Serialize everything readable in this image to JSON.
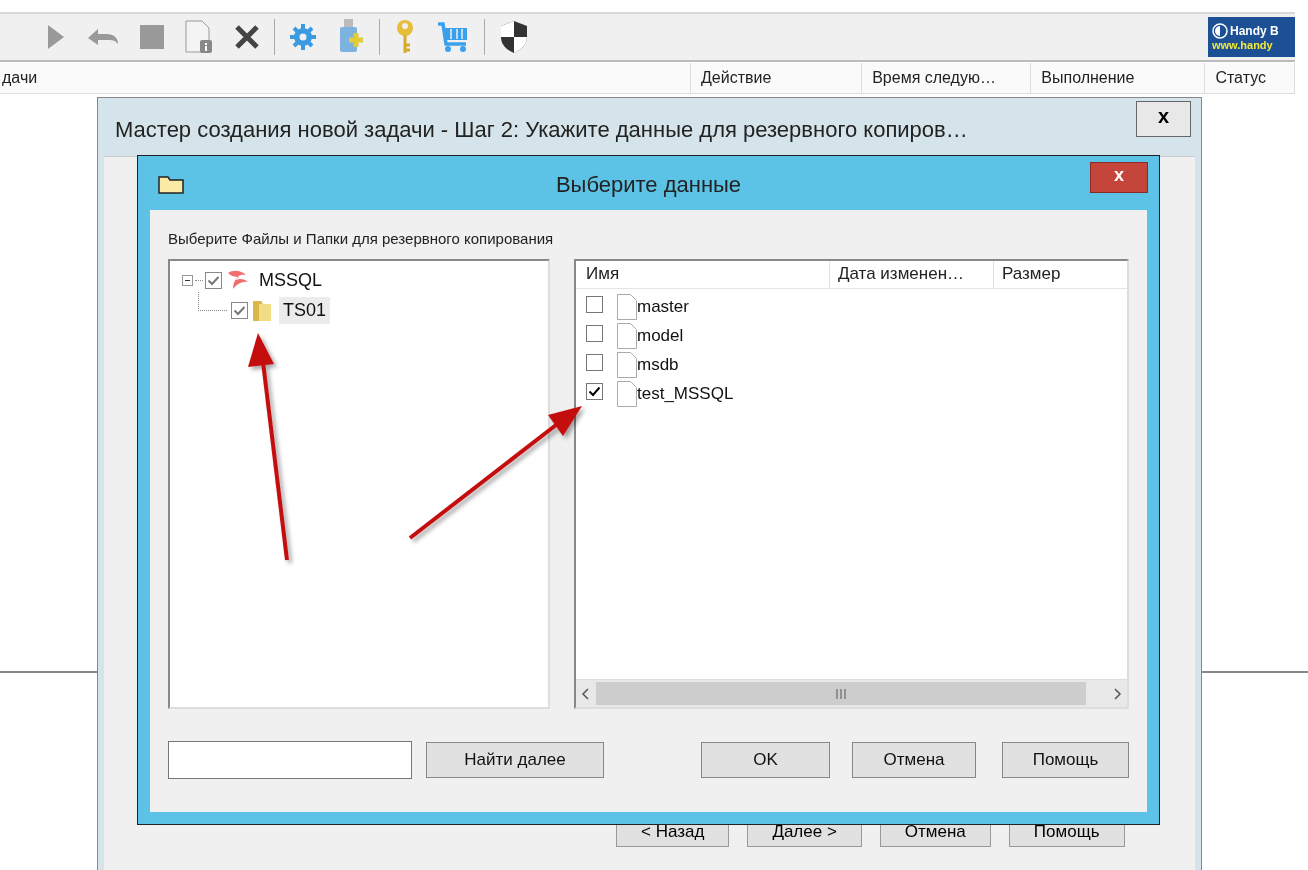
{
  "app": {
    "logo": {
      "line_1": "Handy B",
      "line_2": "www.handy"
    },
    "columns": [
      "дачи",
      "Действие",
      "Время следую…",
      "Выполнение",
      "Статус"
    ]
  },
  "wizard": {
    "title": "Мастер создания новой задачи - Шаг 2: Укажите данные для резервного копиров…",
    "close": "x",
    "buttons": [
      "< Назад",
      "Далее >",
      "Отмена",
      "Помощь"
    ]
  },
  "dialog": {
    "title": "Выберите данные",
    "close": "x",
    "prompt": "Выберите Файлы и Папки для резервного копирования",
    "tree": [
      {
        "label": "MSSQL",
        "kind": "server",
        "checked": true,
        "expanded": true,
        "selected": false,
        "children": [
          {
            "label": "TS01",
            "kind": "folder",
            "checked": true,
            "selected": true
          }
        ]
      }
    ],
    "columns": [
      "Имя",
      "Дата изменен…",
      "Размер"
    ],
    "files": [
      {
        "name": "master",
        "checked": false
      },
      {
        "name": "model",
        "checked": false
      },
      {
        "name": "msdb",
        "checked": false
      },
      {
        "name": "test_MSSQL",
        "checked": true
      }
    ],
    "find_button": "Найти далее",
    "buttons": [
      "OK",
      "Отмена",
      "Помощь"
    ]
  }
}
